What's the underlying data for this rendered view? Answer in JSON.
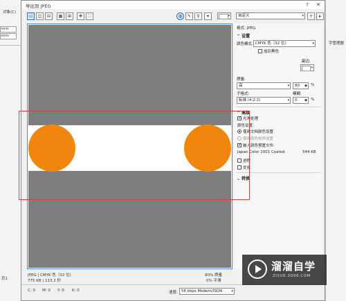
{
  "background_app": {
    "left_menu": "对象(C)",
    "left_unit_1": "mm",
    "left_unit_2": "mm",
    "left_page_tab": "页1",
    "right_label": "字管理器"
  },
  "dialog": {
    "title": "导出到 JPEG",
    "window_buttons": [
      "?",
      "✕"
    ],
    "toolbar": {
      "preset_select": "自定义",
      "color_swatch": ""
    },
    "preview_status": {
      "line1_left": "JPEG  |  CMYK 色（32 位）",
      "line2_left": "775 KB  |  113.2 秒",
      "line1_right": "80% 质量",
      "line2_right": "0% 平滑"
    },
    "bottom_bar": {
      "c": "C: 0",
      "m": "M: 0",
      "y": "Y: 0",
      "k": "K: 0",
      "speed_label": "速度:",
      "speed_value": "56 kbps Modem/ISDN"
    },
    "panel": {
      "format_label": "格式: JPEG",
      "settings_header": "设置",
      "color_mode_label": "颜色模式:",
      "color_mode_value": "CMYK 色（32 位）",
      "dither_label": "加印黑色",
      "matte_label": "副边:",
      "quality_label": "质量:",
      "quality_value": "高",
      "quality_number": "80",
      "percent": "%",
      "subformat_label": "子格式:",
      "subformat_value": "标准 (4:2:2)",
      "blur_label": "模糊:",
      "blur_value": "0",
      "advanced_header": "高级",
      "smoothing_label": "光滑处理",
      "color_settings_label": "颜色设置:",
      "use_doc_color": "使用文档颜色设置",
      "use_proof_color": "使用颜色校样设置",
      "embed_profile": "嵌入颜色预置文件:",
      "profile_name": "Japan Color 2001 Coated",
      "profile_size": "544 KB",
      "progressive_label": "进程",
      "optimize_label": "优化",
      "transform_header": "转换"
    }
  },
  "watermark": {
    "brand_cn": "溜溜自学",
    "brand_url": "ZIXUE.3D66.COM"
  }
}
